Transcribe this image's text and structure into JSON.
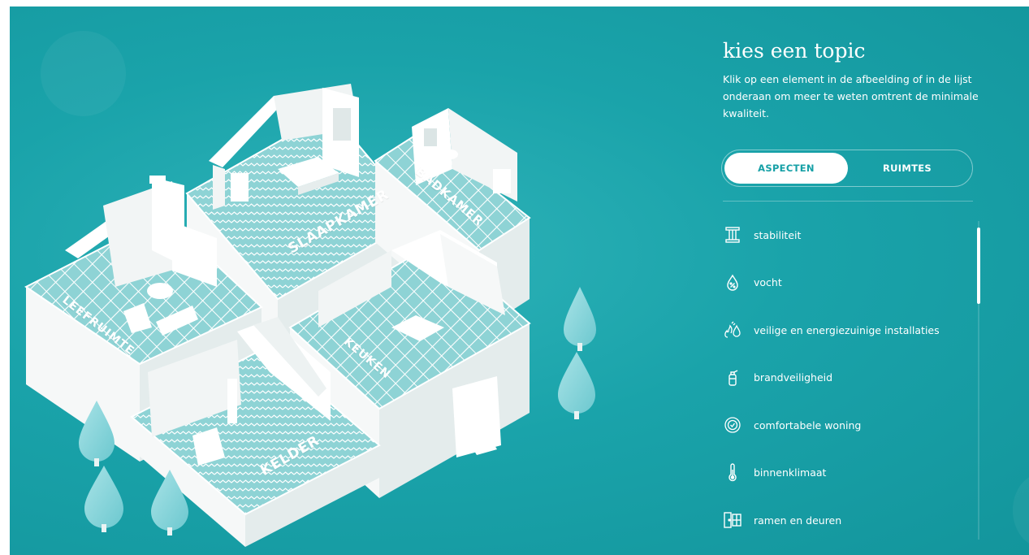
{
  "panel": {
    "title": "kies een topic",
    "intro": "Klik op een element in de afbeelding of in de lijst onderaan om meer te weten omtrent de minimale kwaliteit.",
    "tabs": [
      {
        "label": "ASPECTEN",
        "active": true
      },
      {
        "label": "RUIMTES",
        "active": false
      }
    ],
    "topics": [
      {
        "label": "stabiliteit",
        "icon": "column-icon"
      },
      {
        "label": "vocht",
        "icon": "drop-percent-icon"
      },
      {
        "label": "veilige en energiezuinige installaties",
        "icon": "flame-drop-icon"
      },
      {
        "label": "brandveiligheid",
        "icon": "extinguisher-icon"
      },
      {
        "label": "comfortabele woning",
        "icon": "comfort-badge-icon"
      },
      {
        "label": "binnenklimaat",
        "icon": "thermometer-icon"
      },
      {
        "label": "ramen en deuren",
        "icon": "door-window-icon"
      }
    ]
  },
  "rooms": [
    {
      "label": "SLAAPKAMER"
    },
    {
      "label": "BADKAMER"
    },
    {
      "label": "LEEFRUIMTE"
    },
    {
      "label": "KEUKEN"
    },
    {
      "label": "KELDER"
    }
  ],
  "colors": {
    "background": "#1aa3aa",
    "floor": "#8ed3d5",
    "wall": "#f4f7f7",
    "tree": "#8fd6dc",
    "active_tab_text": "#16a0a6"
  }
}
